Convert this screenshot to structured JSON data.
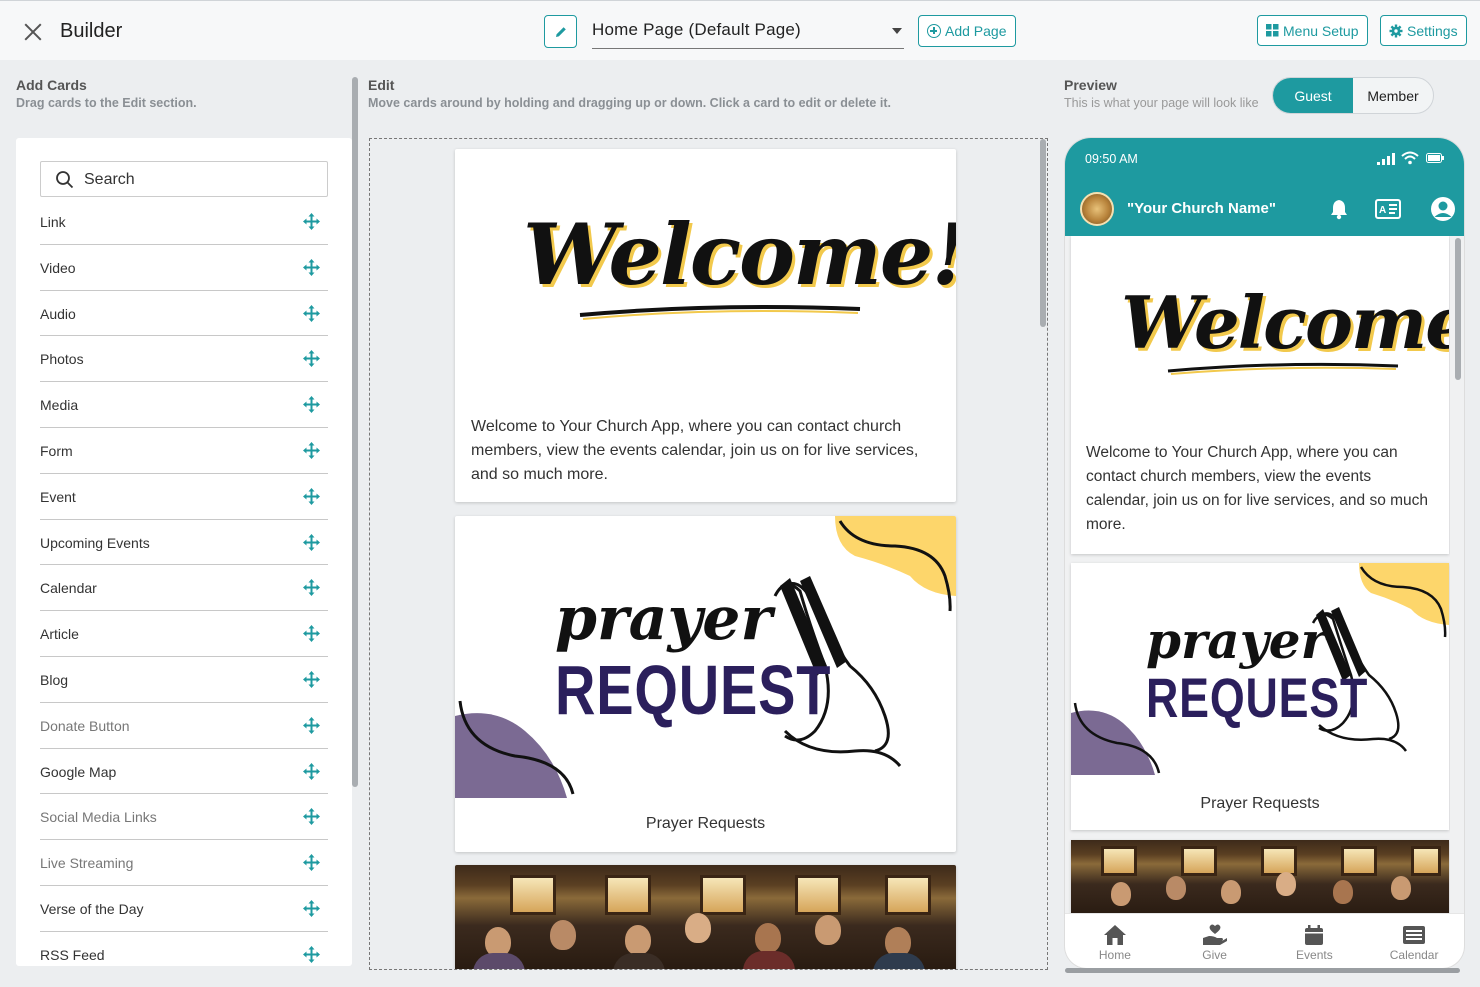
{
  "header": {
    "title": "Builder",
    "page_select": "Home Page (Default Page)",
    "add_page": "Add Page",
    "menu_setup": "Menu Setup",
    "settings": "Settings"
  },
  "add_cards": {
    "title": "Add Cards",
    "subtitle": "Drag cards to the Edit section.",
    "search_placeholder": "Search",
    "items": [
      {
        "label": "Link"
      },
      {
        "label": "Video"
      },
      {
        "label": "Audio"
      },
      {
        "label": "Photos"
      },
      {
        "label": "Media"
      },
      {
        "label": "Form"
      },
      {
        "label": "Event"
      },
      {
        "label": "Upcoming Events"
      },
      {
        "label": "Calendar"
      },
      {
        "label": "Article"
      },
      {
        "label": "Blog"
      },
      {
        "label": "Donate Button"
      },
      {
        "label": "Google Map"
      },
      {
        "label": "Social Media Links"
      },
      {
        "label": "Live Streaming"
      },
      {
        "label": "Verse of the Day"
      },
      {
        "label": "RSS Feed"
      }
    ]
  },
  "edit": {
    "title": "Edit",
    "subtitle": "Move cards around by holding and dragging up or down. Click a card to edit or delete it.",
    "cards": [
      {
        "art": "Welcome!",
        "text": "Welcome to Your Church App, where you can contact church members, view the events calendar, join us on for live services, and so much more."
      },
      {
        "art_top": "prayer",
        "art_bottom": "REQUEST",
        "caption": "Prayer Requests"
      }
    ]
  },
  "preview": {
    "title": "Preview",
    "subtitle": "This is what your page will look like",
    "toggle": {
      "guest": "Guest",
      "member": "Member"
    },
    "phone": {
      "time": "09:50 AM",
      "church_name": "\"Your Church Name\"",
      "welcome_art": "Welcome!",
      "welcome_text": "Welcome to Your Church App, where you can contact church members, view the events calendar, join us on for live services, and so much more.",
      "prayer_top": "prayer",
      "prayer_bottom": "REQUEST",
      "prayer_caption": "Prayer Requests",
      "tabs": [
        {
          "label": "Home",
          "icon": "home-icon"
        },
        {
          "label": "Give",
          "icon": "give-icon"
        },
        {
          "label": "Events",
          "icon": "events-icon"
        },
        {
          "label": "Calendar",
          "icon": "calendar-icon"
        }
      ]
    }
  },
  "colors": {
    "accent": "#1e9aa0",
    "request_purple": "#2b1f5c",
    "yellow_blob": "#fdd66b",
    "purple_blob": "#7b6a93"
  }
}
